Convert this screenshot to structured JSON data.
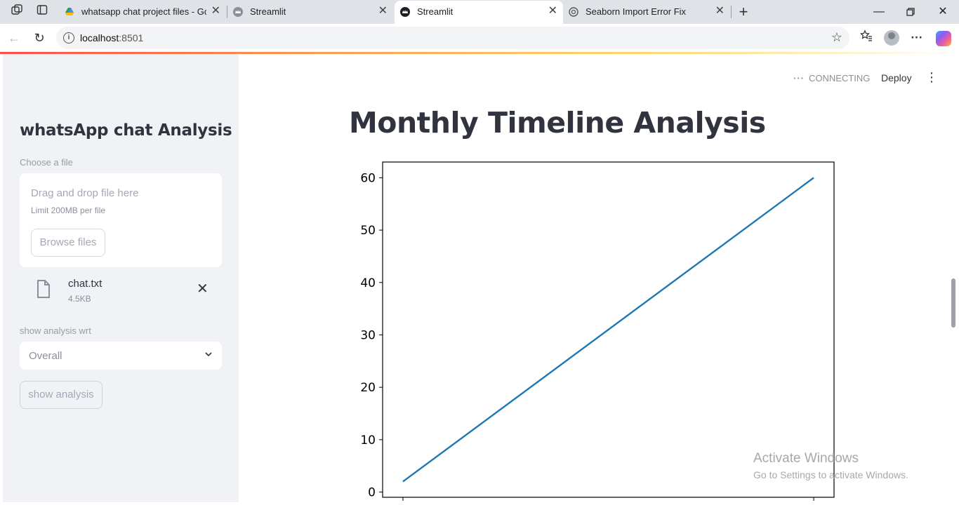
{
  "browser": {
    "tabs": [
      {
        "title": "whatsapp chat project files - Goo",
        "active": false
      },
      {
        "title": "Streamlit",
        "active": false
      },
      {
        "title": "Streamlit",
        "active": true
      },
      {
        "title": "Seaborn Import Error Fix",
        "active": false
      }
    ],
    "address": {
      "host": "localhost",
      "port": ":8501"
    }
  },
  "sidebar": {
    "title": "whatsApp chat Analysis",
    "uploader": {
      "label": "Choose a file",
      "drag_text": "Drag and drop file here",
      "limit_text": "Limit 200MB per file",
      "browse_label": "Browse files"
    },
    "file": {
      "name": "chat.txt",
      "size": "4.5KB"
    },
    "select": {
      "label": "show analysis wrt",
      "value": "Overall"
    },
    "button_label": "show analysis"
  },
  "header": {
    "status": "CONNECTING",
    "deploy": "Deploy"
  },
  "main": {
    "title": "Monthly Timeline Analysis"
  },
  "chart_data": {
    "type": "line",
    "x": [
      0,
      1
    ],
    "series": [
      {
        "values": [
          2,
          60
        ],
        "color": "#1f77b4"
      }
    ],
    "yticks": [
      0,
      10,
      20,
      30,
      40,
      50,
      60
    ],
    "ylim": [
      -1,
      63
    ],
    "title": "",
    "xlabel": "",
    "ylabel": ""
  },
  "watermark": {
    "line1": "Activate Windows",
    "line2": "Go to Settings to activate Windows."
  }
}
